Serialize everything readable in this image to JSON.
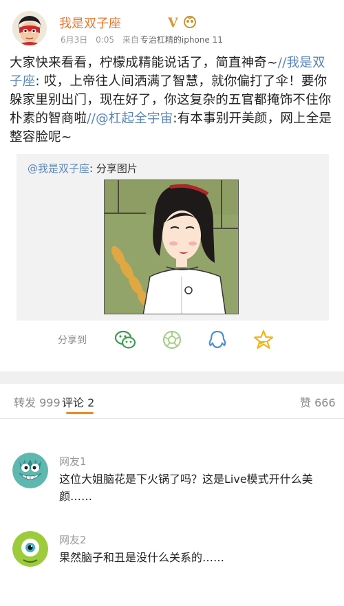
{
  "post": {
    "username": "我是双子座",
    "badge_v": "V",
    "date": "6月3日",
    "time": "0:05",
    "source_prefix": "来自",
    "device": "专治杠精的iphone 11",
    "text_1": "大家快来看看，柠檬成精能说话了，简直神奇~",
    "mention_1": "//我是双子座",
    "text_2": ":  哎，上帝往人间洒满了智慧，就你偏打了伞！要你躲家里别出门，现在好了，你这复杂的五官都掩饰不住你朴素的智商啦",
    "mention_2": "//@杠起全宇宙",
    "text_3": ":有本事别开美颜，网上全是整容脸呢~"
  },
  "share_card": {
    "mention": "@我是双子座",
    "title": ":  分享图片"
  },
  "share_bar": {
    "label": "分享到",
    "icons": [
      "wechat-icon",
      "moments-icon",
      "qq-icon",
      "qzone-icon"
    ]
  },
  "stats": {
    "repost_label": "转发",
    "repost_count": "999",
    "comment_label": "评论",
    "comment_count": "2",
    "like_label": "赞",
    "like_count": "666"
  },
  "comments": [
    {
      "name": "网友1",
      "text": "这位大姐脑花是下火锅了吗？这是Live模式开什么美颜……"
    },
    {
      "name": "网友2",
      "text": "果然脑子和丑是没什么关系的……"
    }
  ],
  "colors": {
    "username": "#e8772e",
    "mention": "#5b86b8",
    "tab_underline": "#f08a24",
    "wechat": "#3a9b4f",
    "qq": "#4a90d9",
    "qzone": "#f3b41b"
  }
}
